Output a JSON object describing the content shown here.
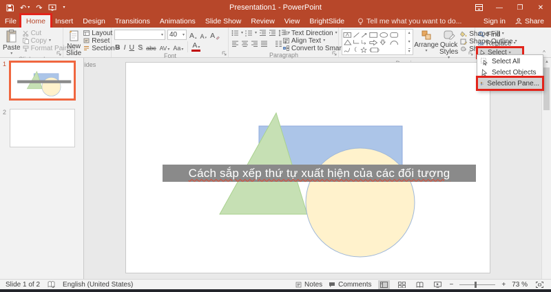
{
  "titlebar": {
    "title": "Presentation1 - PowerPoint",
    "sign_in": "Sign in",
    "share": "Share",
    "tell_me": "Tell me what you want to do..."
  },
  "tabs": [
    "File",
    "Home",
    "Insert",
    "Design",
    "Transitions",
    "Animations",
    "Slide Show",
    "Review",
    "View",
    "BrightSlide"
  ],
  "ribbon": {
    "clipboard": {
      "label": "Clipboard",
      "paste": "Paste",
      "cut": "Cut",
      "copy": "Copy",
      "format_painter": "Format Painter"
    },
    "slides": {
      "label": "Slides",
      "new_slide": "New Slide",
      "layout": "Layout",
      "reset": "Reset",
      "section": "Section"
    },
    "font": {
      "label": "Font",
      "font_size": "40",
      "bold": "B",
      "italic": "I",
      "underline": "U",
      "shadow": "S",
      "strikethrough": "abc",
      "char_spacing": "AV",
      "change_case": "Aa",
      "font_color": "A",
      "grow": "A",
      "shrink": "A",
      "clear": "A"
    },
    "paragraph": {
      "label": "Paragraph",
      "text_direction": "Text Direction",
      "align_text": "Align Text",
      "convert_to_smartart": "Convert to SmartArt"
    },
    "drawing": {
      "label": "Drawing",
      "arrange": "Arrange",
      "quick_styles": "Quick Styles",
      "shape_fill": "Shape Fill",
      "shape_outline": "Shape Outline",
      "shape_effects": "Shape Effects"
    },
    "editing": {
      "find": "Find",
      "replace": "Replace",
      "select": "Select",
      "replace_icon_text": "ab"
    }
  },
  "select_menu": {
    "items": [
      {
        "label": "Select All"
      },
      {
        "label": "Select Objects"
      },
      {
        "label": "Selection Pane..."
      }
    ]
  },
  "slides_panel": {
    "slides": [
      {
        "number": "1"
      },
      {
        "number": "2"
      }
    ]
  },
  "slide": {
    "caption": "Cách sắp xếp thứ tự xuất hiện của các đối tượng"
  },
  "statusbar": {
    "slide_indicator": "Slide 1 of 2",
    "language": "English (United States)",
    "notes": "Notes",
    "comments": "Comments",
    "zoom_out": "−",
    "zoom_in": "+",
    "zoom_level": "73 %"
  },
  "colors": {
    "accent": "#B7472A",
    "annotation": "#E2231A",
    "rect_fill": "#ACC5E8",
    "rect_stroke": "#8FAADC",
    "triangle_fill": "#C6E0B4",
    "triangle_stroke": "#A9D18E",
    "circle_fill": "#FFF2CC",
    "circle_stroke": "#9FB8D9",
    "caption_bg": "#8A8A8A"
  }
}
